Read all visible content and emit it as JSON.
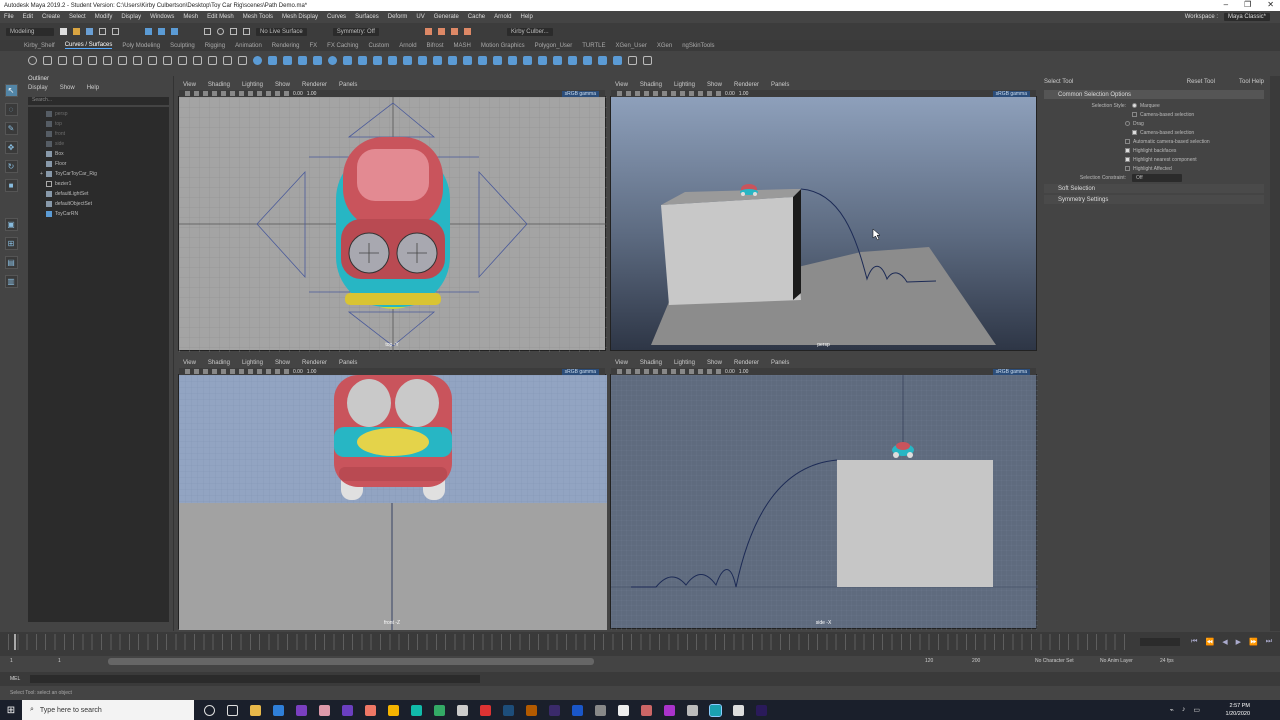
{
  "window": {
    "title": "Autodesk Maya 2019.2 - Student Version: C:\\Users\\Kirby Culbertson\\Desktop\\Toy Car Rig\\scenes\\Path Demo.ma*",
    "controls": [
      "–",
      "❐",
      "✕"
    ]
  },
  "menu": {
    "items": [
      "File",
      "Edit",
      "Create",
      "Select",
      "Modify",
      "Display",
      "Windows",
      "Mesh",
      "Edit Mesh",
      "Mesh Tools",
      "Mesh Display",
      "Curves",
      "Surfaces",
      "Deform",
      "UV",
      "Generate",
      "Cache",
      "Arnold",
      "Help"
    ],
    "workspace_label": "Workspace :",
    "workspace_value": "Maya Classic*"
  },
  "status": {
    "mode": "Modeling",
    "live_surface": "No Live Surface",
    "symmetry": "Symmetry: Off",
    "user": "Kirby Culber..."
  },
  "shelf": {
    "tabs": [
      "Kirby_Shelf",
      "Curves / Surfaces",
      "Poly Modeling",
      "Sculpting",
      "Rigging",
      "Animation",
      "Rendering",
      "FX",
      "FX Caching",
      "Custom",
      "Arnold",
      "Bifrost",
      "MASH",
      "Motion Graphics",
      "Polygon_User",
      "TURTLE",
      "XGen_User",
      "XGen",
      "ngSkinTools"
    ],
    "active_tab": "Curves / Surfaces"
  },
  "outliner": {
    "title": "Outliner",
    "menus": [
      "Display",
      "Show",
      "Help"
    ],
    "search_placeholder": "Search...",
    "items": [
      {
        "label": "persp",
        "dim": true
      },
      {
        "label": "top",
        "dim": true
      },
      {
        "label": "front",
        "dim": true
      },
      {
        "label": "side",
        "dim": true
      },
      {
        "label": "Box",
        "dim": false
      },
      {
        "label": "Floor",
        "dim": false
      },
      {
        "label": "ToyCarToyCar_Rig",
        "dim": false
      },
      {
        "label": "bezier1",
        "dim": false
      },
      {
        "label": "defaultLightSet",
        "dim": false
      },
      {
        "label": "defaultObjectSet",
        "dim": false
      },
      {
        "label": "ToyCarRN",
        "dim": false
      }
    ]
  },
  "viewport_menu": [
    "View",
    "Shading",
    "Lighting",
    "Show",
    "Renderer",
    "Panels"
  ],
  "viewport_toolbar": {
    "near": "0.00",
    "far": "1.00",
    "gamma": "sRGB gamma"
  },
  "viewports": {
    "top": {
      "camera": "top -Y"
    },
    "persp": {
      "camera": "persp"
    },
    "front": {
      "camera": "front -Z"
    },
    "side": {
      "camera": "side -X"
    }
  },
  "attribute_editor": {
    "title": "Select Tool",
    "buttons": [
      "Reset Tool",
      "Tool Help"
    ],
    "section_common": "Common Selection Options",
    "selection_style_label": "Selection Style:",
    "marquee": "Marquee",
    "camera_based_1": "Camera-based selection",
    "drag": "Drag",
    "camera_based_2": "Camera-based selection",
    "auto_camera": "Automatic camera-based selection",
    "highlight_backfaces": "Highlight backfaces",
    "highlight_nearest": "Highlight nearest component",
    "highlight_affected": "Highlight Affected",
    "constraint_label": "Selection Constraint:",
    "constraint_value": "Off",
    "section_soft": "Soft Selection",
    "section_symmetry": "Symmetry Settings"
  },
  "timeline": {
    "current_frame": "1",
    "range_start": "1",
    "range_inner_start": "1",
    "range_inner_end": "120",
    "range_end": "120",
    "anim_end": "200",
    "character_set": "No Character Set",
    "anim_layer": "No Anim Layer",
    "fps": "24 fps"
  },
  "mel": {
    "label": "MEL",
    "help": "Select Tool: select an object"
  },
  "taskbar": {
    "search_placeholder": "Type here to search",
    "time": "2:57 PM",
    "date": "1/20/2020"
  }
}
